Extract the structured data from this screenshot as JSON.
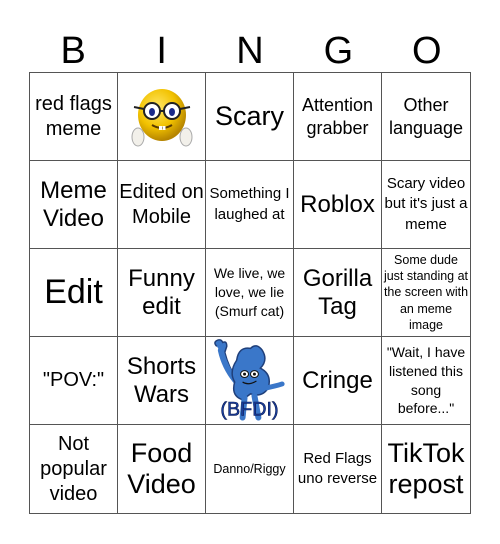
{
  "header": [
    "B",
    "I",
    "N",
    "G",
    "O"
  ],
  "cells": [
    {
      "text": "red flags meme"
    },
    {
      "text": "",
      "image": "nerd-smiley-with-glasses"
    },
    {
      "text": "Scary"
    },
    {
      "text": "Attention grabber"
    },
    {
      "text": "Other language"
    },
    {
      "text": "Meme Video"
    },
    {
      "text": "Edited on Mobile"
    },
    {
      "text": "Something I laughed at"
    },
    {
      "text": "Roblox"
    },
    {
      "text": "Scary video but it's just a meme"
    },
    {
      "text": "Edit"
    },
    {
      "text": "Funny edit"
    },
    {
      "text": "We live, we love, we lie (Smurf cat)"
    },
    {
      "text": "Gorilla Tag"
    },
    {
      "text": "Some dude just standing at the screen with an meme image"
    },
    {
      "text": "\"POV:\""
    },
    {
      "text": "Shorts Wars"
    },
    {
      "text": "(BFDI)",
      "image": "bfdi-four-character"
    },
    {
      "text": "Cringe"
    },
    {
      "text": "\"Wait, I have listened this song before...\""
    },
    {
      "text": "Not popular video"
    },
    {
      "text": "Food Video"
    },
    {
      "text": "Danno/Riggy"
    },
    {
      "text": "Red Flags uno reverse"
    },
    {
      "text": "TikTok repost"
    }
  ],
  "colors": {
    "grid_line": "#555555",
    "bfdi_blue": "#3a77c9",
    "smiley_yellow": "#f2c200"
  }
}
